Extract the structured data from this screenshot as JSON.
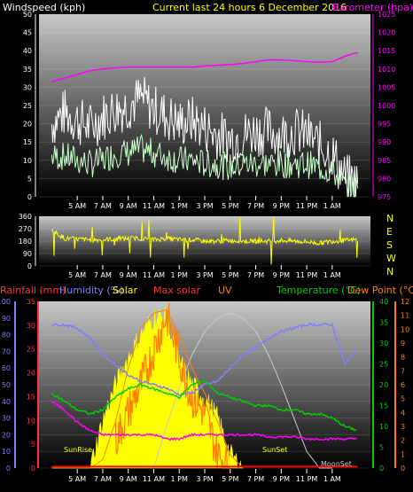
{
  "header": {
    "wind_label": "Windspeed (kph)",
    "title": "Current last 24 hours 6 December 2016",
    "baro_label": "Barometer (hpa)"
  },
  "colors": {
    "wind_axis": "#ffffff",
    "title": "#ffff00",
    "barometer": "#ff00ff",
    "gust": "#ffffff",
    "wind_avg": "#c8ffc8",
    "direction": "#ffff00",
    "rain_label": "#ff3333",
    "humidity": "#7f7fff",
    "solar": "#ffff00",
    "max_solar": "#ff8000",
    "uv": "#ff8000",
    "temperature": "#00cc00",
    "dew_point": "#ff8000",
    "rain": "#ff0000",
    "sun_arc": "#c8c8c8",
    "plot_top": "#c8c8c8",
    "plot_bottom": "#000000"
  },
  "chart_data": [
    {
      "id": "wind_pressure",
      "type": "line",
      "title": "Current last 24 hours 6 December 2016",
      "x_ticks": [
        "5 AM",
        "7 AM",
        "9 AM",
        "11 AM",
        "1 PM",
        "3 PM",
        "5 PM",
        "7 PM",
        "9 PM",
        "11 PM",
        "1 AM"
      ],
      "y_left": {
        "label": "Windspeed (kph)",
        "ticks": [
          "0",
          "5",
          "10",
          "15",
          "20",
          "25",
          "30",
          "35",
          "40",
          "45",
          "50"
        ],
        "range": [
          0,
          50
        ]
      },
      "y_right": {
        "label": "Barometer (hpa)",
        "ticks": [
          "975",
          "980",
          "985",
          "990",
          "995",
          "1000",
          "1005",
          "1010",
          "1015",
          "1020",
          "1025"
        ],
        "range": [
          975,
          1025
        ]
      },
      "series": [
        {
          "name": "Windspeed (kph)",
          "axis": "left",
          "kind": "gust",
          "x": [
            3,
            4,
            5,
            6,
            7,
            8,
            9,
            10,
            11,
            12,
            13,
            14,
            15,
            16,
            17,
            18,
            19,
            20,
            21,
            22,
            23,
            24,
            25,
            26,
            27
          ],
          "y": [
            20,
            23,
            21,
            19,
            22,
            24,
            25,
            27,
            24,
            22,
            20,
            21,
            19,
            17,
            16,
            17,
            18,
            18,
            17,
            18,
            17,
            14,
            12,
            5,
            4
          ]
        },
        {
          "name": "Windspeed (kph)",
          "axis": "left",
          "kind": "average",
          "x": [
            3,
            4,
            5,
            6,
            7,
            8,
            9,
            10,
            11,
            12,
            13,
            14,
            15,
            16,
            17,
            18,
            19,
            20,
            21,
            22,
            23,
            24,
            25,
            26,
            27
          ],
          "y": [
            11,
            11,
            10,
            9,
            10,
            12,
            12,
            13,
            12,
            11,
            10,
            10,
            9,
            9,
            8,
            9,
            9,
            9,
            9,
            9,
            9,
            8,
            7,
            3,
            2
          ]
        },
        {
          "name": "Barometer (hpa)",
          "axis": "right",
          "x": [
            3,
            4,
            5,
            6,
            7,
            8,
            9,
            10,
            11,
            12,
            13,
            14,
            15,
            16,
            17,
            18,
            19,
            20,
            21,
            22,
            23,
            24,
            25,
            26,
            27
          ],
          "y": [
            1006.5,
            1007.5,
            1008.5,
            1009.5,
            1010.0,
            1010.3,
            1010.5,
            1010.5,
            1010.5,
            1010.5,
            1010.5,
            1010.5,
            1010.8,
            1011.0,
            1011.2,
            1011.5,
            1012.0,
            1012.5,
            1012.4,
            1012.3,
            1012.0,
            1011.8,
            1012.0,
            1013.5,
            1014.5
          ]
        }
      ]
    },
    {
      "id": "wind_direction",
      "type": "line",
      "y_left": {
        "ticks": [
          "0",
          "90",
          "180",
          "270",
          "360"
        ],
        "range": [
          0,
          360
        ]
      },
      "y_right": {
        "ticks": [
          "N",
          "W",
          "S",
          "E",
          "N"
        ]
      },
      "series": [
        {
          "name": "Wind direction",
          "x": [
            3,
            4,
            5,
            6,
            7,
            8,
            9,
            10,
            11,
            12,
            13,
            14,
            15,
            16,
            17,
            18,
            19,
            20,
            21,
            22,
            23,
            24,
            25,
            26,
            27
          ],
          "y": [
            260,
            200,
            195,
            190,
            190,
            195,
            200,
            200,
            190,
            200,
            190,
            190,
            180,
            180,
            185,
            180,
            180,
            180,
            185,
            180,
            175,
            165,
            180,
            185,
            190
          ]
        }
      ]
    },
    {
      "id": "solar_temp",
      "type": "line",
      "legend": [
        "Rainfall (mm)",
        "Humidity (%)",
        "Solar",
        "Max solar",
        "UV",
        "Temperature (°C)",
        "Dew Point (°C)"
      ],
      "annotations": [
        "SunRise",
        "SunSet",
        "MoonSet"
      ],
      "y_axes": [
        {
          "label": "Humidity (%)",
          "ticks": [
            "0",
            "10",
            "20",
            "30",
            "40",
            "50",
            "60",
            "70",
            "80",
            "90",
            "100"
          ],
          "range": [
            0,
            100
          ]
        },
        {
          "label": "Rainfall (mm)",
          "ticks": [
            "0",
            "5",
            "10",
            "15",
            "20",
            "25",
            "30",
            "35"
          ],
          "range": [
            0,
            35
          ]
        },
        {
          "label": "Temperature (°C)",
          "ticks": [
            "0",
            "5",
            "10",
            "15",
            "20",
            "25",
            "30",
            "35",
            "40"
          ],
          "range": [
            0,
            40
          ]
        },
        {
          "label": "UV",
          "ticks": [
            "0",
            "1",
            "2",
            "3",
            "4",
            "5",
            "6",
            "7",
            "8",
            "9",
            "10",
            "11",
            "12"
          ],
          "range": [
            0,
            12
          ]
        }
      ],
      "series": [
        {
          "name": "Humidity (%)",
          "axis": "humidity",
          "x": [
            3,
            4,
            5,
            6,
            7,
            8,
            9,
            10,
            11,
            12,
            13,
            14,
            15,
            16,
            17,
            18,
            19,
            20,
            21,
            22,
            23,
            24,
            25,
            26,
            27
          ],
          "y": [
            86,
            86,
            84,
            78,
            68,
            62,
            56,
            52,
            50,
            48,
            44,
            45,
            50,
            52,
            60,
            68,
            72,
            78,
            82,
            84,
            86,
            86,
            86,
            62,
            72
          ]
        },
        {
          "name": "Temperature (°C)",
          "axis": "temperature",
          "x": [
            3,
            4,
            5,
            6,
            7,
            8,
            9,
            10,
            11,
            12,
            13,
            14,
            15,
            16,
            17,
            18,
            19,
            20,
            21,
            22,
            23,
            24,
            25,
            26,
            27
          ],
          "y": [
            18,
            16,
            14,
            13,
            14,
            17,
            19,
            20,
            19,
            18,
            17,
            20,
            21,
            18,
            17,
            16,
            15,
            15,
            14,
            14,
            13,
            13,
            12,
            10,
            9
          ]
        },
        {
          "name": "Dew Point (°C)",
          "axis": "temperature",
          "x": [
            3,
            4,
            5,
            6,
            7,
            8,
            9,
            10,
            11,
            12,
            13,
            14,
            15,
            16,
            17,
            18,
            19,
            20,
            21,
            22,
            23,
            24,
            25,
            26,
            27
          ],
          "y": [
            16,
            14,
            11,
            9,
            8,
            8,
            8,
            8,
            8,
            7,
            7,
            8,
            8,
            8,
            8,
            8,
            8,
            7.5,
            7.5,
            7.5,
            7,
            7,
            7,
            7,
            7
          ]
        },
        {
          "name": "Solar",
          "axis": "humidity",
          "x": [
            3,
            5,
            6,
            7,
            8,
            9,
            10,
            11,
            12,
            13,
            14,
            15,
            16,
            17,
            18
          ],
          "y": [
            0,
            0,
            0,
            28,
            50,
            66,
            80,
            90,
            90,
            64,
            50,
            42,
            30,
            8,
            0
          ]
        },
        {
          "name": "Max solar",
          "axis": "humidity",
          "x": [
            6,
            7,
            8,
            9,
            10,
            11,
            12,
            13,
            14,
            15,
            16,
            17,
            18
          ],
          "y": [
            0,
            5,
            28,
            60,
            84,
            93,
            95,
            80,
            60,
            45,
            28,
            8,
            0
          ]
        },
        {
          "name": "UV",
          "axis": "uv",
          "x": [
            8,
            9,
            10,
            11,
            12,
            13,
            14,
            15,
            16,
            17
          ],
          "y": [
            2,
            4,
            6,
            8.5,
            11,
            8,
            5,
            4,
            1,
            0
          ]
        },
        {
          "name": "Sun elevation",
          "axis": "humidity",
          "x": [
            11,
            12,
            13,
            14,
            15,
            16,
            17,
            18,
            19,
            20,
            21,
            22,
            23,
            24,
            25
          ],
          "y": [
            0,
            25,
            48,
            68,
            82,
            90,
            93,
            90,
            82,
            68,
            50,
            30,
            10,
            0,
            0
          ]
        },
        {
          "name": "Rainfall (mm)",
          "axis": "rain",
          "x": [
            3,
            27
          ],
          "y": [
            0.3,
            0.3
          ]
        }
      ]
    }
  ]
}
